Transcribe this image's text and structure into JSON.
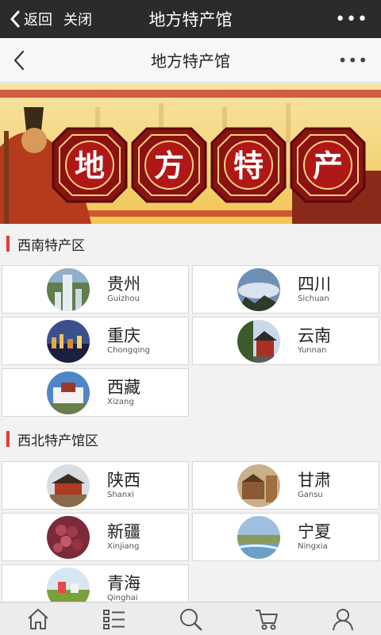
{
  "topbar": {
    "back_label": "返回",
    "close_label": "关闭",
    "title": "地方特产馆",
    "more": "•••"
  },
  "subheader": {
    "title": "地方特产馆",
    "more": "•••"
  },
  "banner": {
    "chars": [
      "地",
      "方",
      "特",
      "产"
    ]
  },
  "sections": [
    {
      "title": "西南特产区",
      "items": [
        {
          "cn": "贵州",
          "en": "Guizhou",
          "icon": "waterfall-photo"
        },
        {
          "cn": "四川",
          "en": "Sichuan",
          "icon": "mountain-cloud-photo"
        },
        {
          "cn": "重庆",
          "en": "Chongqing",
          "icon": "city-night-photo"
        },
        {
          "cn": "云南",
          "en": "Yunnan",
          "icon": "pavilion-photo"
        },
        {
          "cn": "西藏",
          "en": "Xizang",
          "icon": "potala-palace-photo"
        }
      ]
    },
    {
      "title": "西北特产馆区",
      "items": [
        {
          "cn": "陕西",
          "en": "Shanxi",
          "icon": "city-gate-photo"
        },
        {
          "cn": "甘肃",
          "en": "Gansu",
          "icon": "desert-fortress-photo"
        },
        {
          "cn": "新疆",
          "en": "Xinjiang",
          "icon": "grapes-photo"
        },
        {
          "cn": "宁夏",
          "en": "Ningxia",
          "icon": "wetland-photo"
        },
        {
          "cn": "青海",
          "en": "Qinghai",
          "icon": "grassland-photo"
        }
      ]
    }
  ],
  "tabbar": [
    "home-icon",
    "list-icon",
    "search-icon",
    "cart-icon",
    "profile-icon"
  ],
  "colors": {
    "accent": "#e33b3b",
    "topbar": "#2b2b2e",
    "banner_red": "#9b1a1a",
    "banner_gold": "#f3c64a"
  }
}
